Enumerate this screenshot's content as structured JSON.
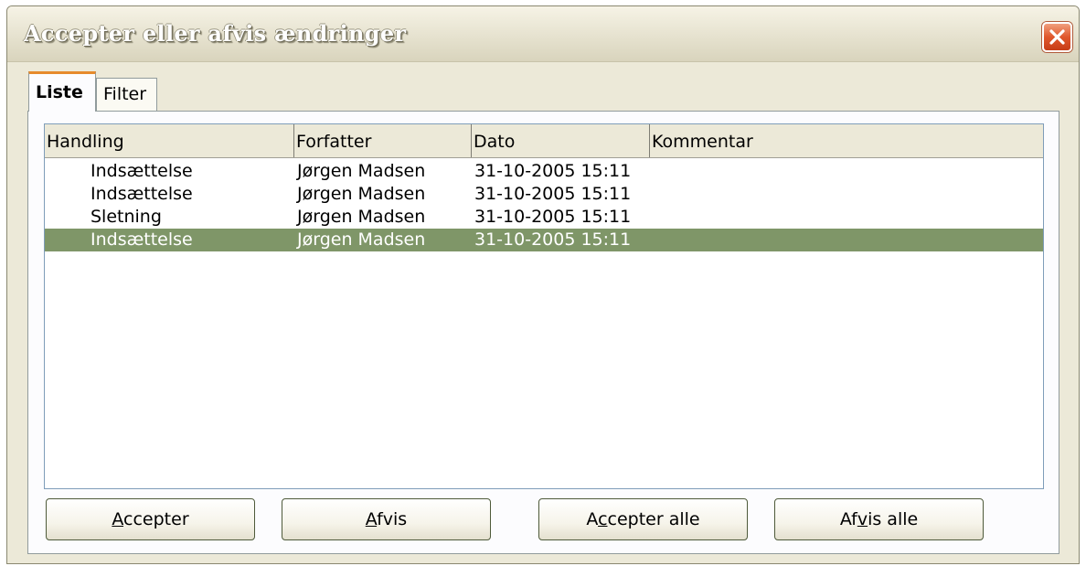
{
  "window": {
    "title": "Accepter eller afvis ændringer",
    "close_icon": "close-x-icon"
  },
  "tabs": [
    {
      "label": "Liste",
      "active": true
    },
    {
      "label": "Filter",
      "active": false
    }
  ],
  "list": {
    "columns": [
      "Handling",
      "Forfatter",
      "Dato",
      "Kommentar"
    ],
    "rows": [
      {
        "handling": "Indsættelse",
        "forfatter": "Jørgen Madsen",
        "dato": "31-10-2005 15:11",
        "kommentar": "",
        "selected": false
      },
      {
        "handling": "Indsættelse",
        "forfatter": "Jørgen Madsen",
        "dato": "31-10-2005 15:11",
        "kommentar": "",
        "selected": false
      },
      {
        "handling": "Sletning",
        "forfatter": "Jørgen Madsen",
        "dato": "31-10-2005 15:11",
        "kommentar": "",
        "selected": false
      },
      {
        "handling": "Indsættelse",
        "forfatter": "Jørgen Madsen",
        "dato": "31-10-2005 15:11",
        "kommentar": "",
        "selected": true
      }
    ]
  },
  "buttons": {
    "accept": {
      "pre": "",
      "key": "A",
      "post": "ccepter"
    },
    "reject": {
      "pre": "",
      "key": "A",
      "post": "fvis"
    },
    "accept_all": {
      "pre": "A",
      "key": "c",
      "post": "cepter alle"
    },
    "reject_all": {
      "pre": "Af",
      "key": "v",
      "post": "is alle"
    }
  },
  "colors": {
    "selection": "#7f9668",
    "active_tab_accent": "#e68b2c",
    "dialog_background": "#ece9d8"
  }
}
